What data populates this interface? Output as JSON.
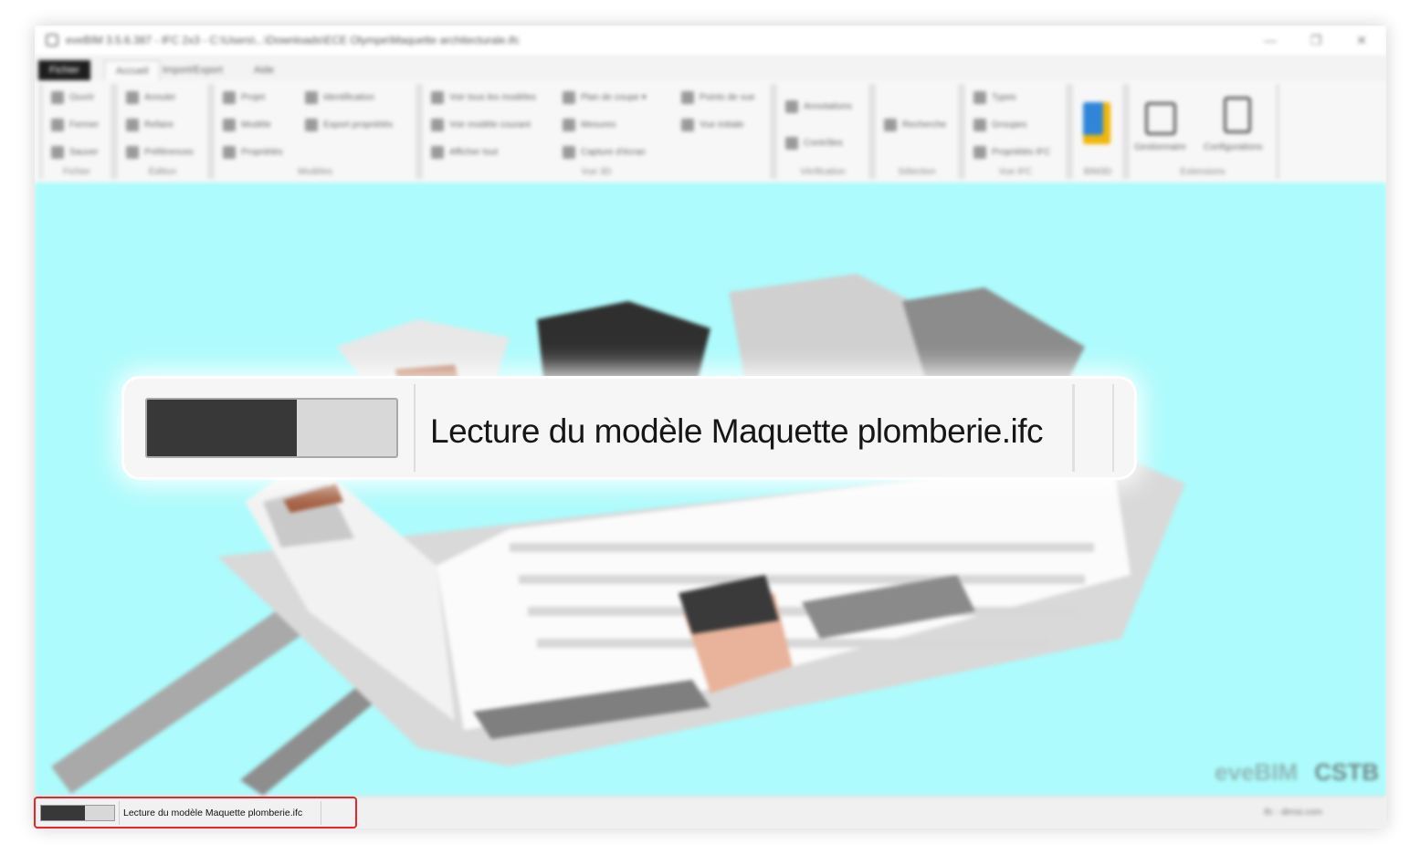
{
  "window": {
    "title": "eveBIM 3.5.6.387 - IFC 2x3 - C:\\Users\\...\\Downloads\\ECE Olympe\\Maquette architecturale.ifc",
    "minimize_glyph": "—",
    "maximize_glyph": "❐",
    "close_glyph": "✕"
  },
  "tabs": [
    {
      "label": "Fichier"
    },
    {
      "label": "Accueil"
    },
    {
      "label": "Import/Export"
    },
    {
      "label": "Aide"
    }
  ],
  "ribbon": {
    "groups": [
      {
        "label": "Fichier",
        "items": [
          "Ouvrir",
          "Fermer",
          "Sauver"
        ]
      },
      {
        "label": "Édition",
        "items": [
          "Annuler",
          "Refaire",
          "Préférences"
        ]
      },
      {
        "label": "Modèles",
        "items": [
          "Projet",
          "Modèle",
          "Propriétés",
          "Identification",
          "Export propriétés"
        ]
      },
      {
        "label": "Vue 3D",
        "items": [
          "Voir tous les modèles",
          "Voir modèle courant",
          "Afficher tout",
          "Plan de coupe",
          "Mesures",
          "Capture d'écran",
          "Points de vue",
          "Vue initiale"
        ]
      },
      {
        "label": "Vérification",
        "items": [
          "Annotations",
          "Contrôles"
        ]
      },
      {
        "label": "Sélection",
        "items": [
          "Recherche"
        ]
      },
      {
        "label": "Vue IFC",
        "items": [
          "Types",
          "Groupes",
          "Propriétés IFC"
        ]
      },
      {
        "label": "BIM3D",
        "items": []
      },
      {
        "label": "Extensions",
        "items": [
          "Gestionnaire",
          "Configurations"
        ]
      }
    ]
  },
  "viewport": {
    "background": "#adfbfc",
    "watermark_left": "eveBIM",
    "watermark_right": "CSTB"
  },
  "status": {
    "loading_text": "Lecture du modèle Maquette plomberie.ifc",
    "progress_fraction": 0.6,
    "right_text": "ifc - dimsi.com"
  },
  "colors": {
    "highlight_border": "#e8252b",
    "progress_fill": "#383838"
  }
}
